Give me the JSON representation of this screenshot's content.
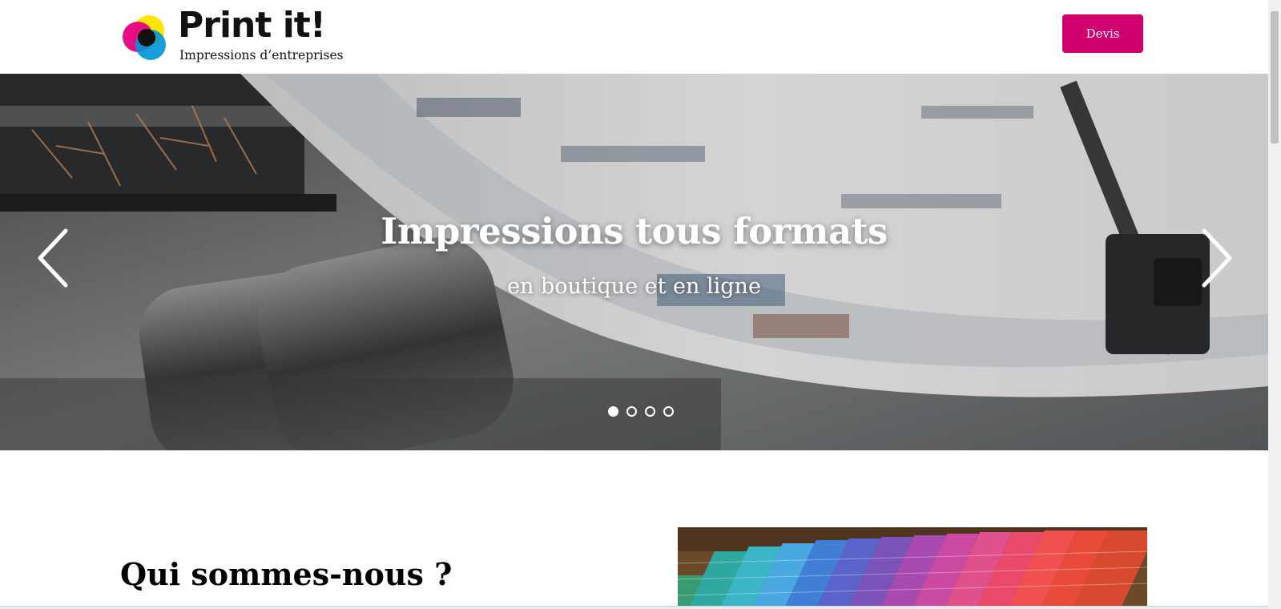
{
  "brand": {
    "name": "Print it!",
    "tagline": "Impressions d’entreprises",
    "colors": {
      "accent": "#d0006f",
      "cyan": "#00a8e8",
      "magenta": "#e6007e",
      "yellow": "#ffe600",
      "black": "#111111"
    }
  },
  "header": {
    "cta_label": "Devis"
  },
  "hero": {
    "title": "Impressions tous formats",
    "subtitle": "en boutique et en ligne",
    "prev_icon": "chevron-left-icon",
    "next_icon": "chevron-right-icon",
    "slides": [
      {
        "index": 1,
        "active": true
      },
      {
        "index": 2,
        "active": false
      },
      {
        "index": 3,
        "active": false
      },
      {
        "index": 4,
        "active": false
      }
    ]
  },
  "about": {
    "title": "Qui sommes-nous ?"
  }
}
